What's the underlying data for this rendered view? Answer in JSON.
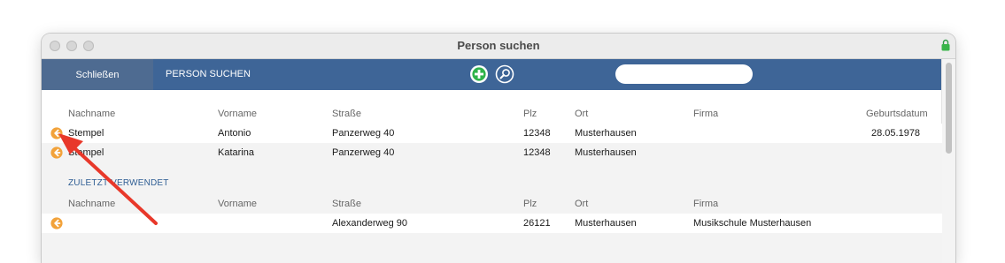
{
  "window": {
    "title": "Person suchen"
  },
  "toolbar": {
    "close_label": "Schließen",
    "title": "PERSON SUCHEN",
    "search_value": "",
    "accent": "#3e6597"
  },
  "table": {
    "columns": [
      "Nachname",
      "Vorname",
      "Straße",
      "Plz",
      "Ort",
      "Firma",
      "Geburtsdatum"
    ],
    "rows": [
      {
        "nachname": "Stempel",
        "vorname": "Antonio",
        "strasse": "Panzerweg 40",
        "plz": "12348",
        "ort": "Musterhausen",
        "firma": "",
        "geburtsdatum": "28.05.1978"
      },
      {
        "nachname": "Stempel",
        "vorname": "Katarina",
        "strasse": "Panzerweg 40",
        "plz": "12348",
        "ort": "Musterhausen",
        "firma": "",
        "geburtsdatum": ""
      }
    ]
  },
  "recent": {
    "label": "ZULETZT VERWENDET",
    "columns": [
      "Nachname",
      "Vorname",
      "Straße",
      "Plz",
      "Ort",
      "Firma"
    ],
    "rows": [
      {
        "nachname": "",
        "vorname": "",
        "strasse": "Alexanderweg 90",
        "plz": "26121",
        "ort": "Musterhausen",
        "firma": "Musikschule Musterhausen"
      }
    ]
  },
  "icons": {
    "add": "plus-circle-icon",
    "search": "magnifier-icon",
    "row_action": "arrow-left-circle-icon",
    "lock": "lock-icon",
    "annotation": "red-arrow-annotation"
  },
  "colors": {
    "orange": "#f2a23a",
    "green": "#2fb34a",
    "annotation": "#e8382a"
  }
}
